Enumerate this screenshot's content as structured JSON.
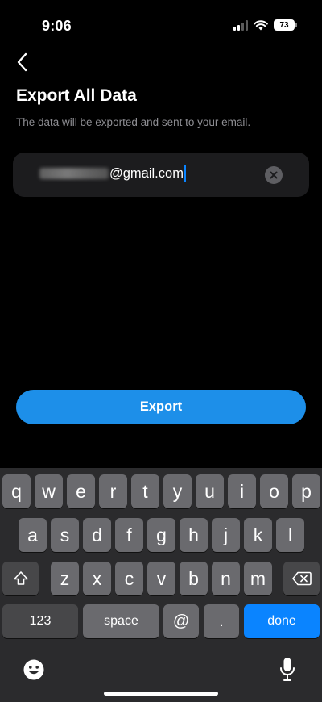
{
  "status_bar": {
    "time": "9:06",
    "battery": "73"
  },
  "header": {
    "title": "Export All Data",
    "subtitle": "The data will be exported and sent to your email."
  },
  "email_field": {
    "value_suffix": "@gmail.com"
  },
  "export_button": {
    "label": "Export"
  },
  "keyboard": {
    "row1": [
      "q",
      "w",
      "e",
      "r",
      "t",
      "y",
      "u",
      "i",
      "o",
      "p"
    ],
    "row2": [
      "a",
      "s",
      "d",
      "f",
      "g",
      "h",
      "j",
      "k",
      "l"
    ],
    "row3": [
      "z",
      "x",
      "c",
      "v",
      "b",
      "n",
      "m"
    ],
    "numbers_label": "123",
    "space_label": "space",
    "at_label": "@",
    "dot_label": ".",
    "done_label": "done"
  },
  "colors": {
    "accent": "#1d8fe9",
    "done_key": "#0a84ff",
    "background": "#000000",
    "field_background": "#1c1c1e",
    "subtitle_text": "#8e8e93"
  },
  "icons": [
    "back-chevron-icon",
    "signal-icon",
    "wifi-icon",
    "battery-icon",
    "clear-icon",
    "shift-icon",
    "backspace-icon",
    "emoji-icon",
    "microphone-icon"
  ]
}
